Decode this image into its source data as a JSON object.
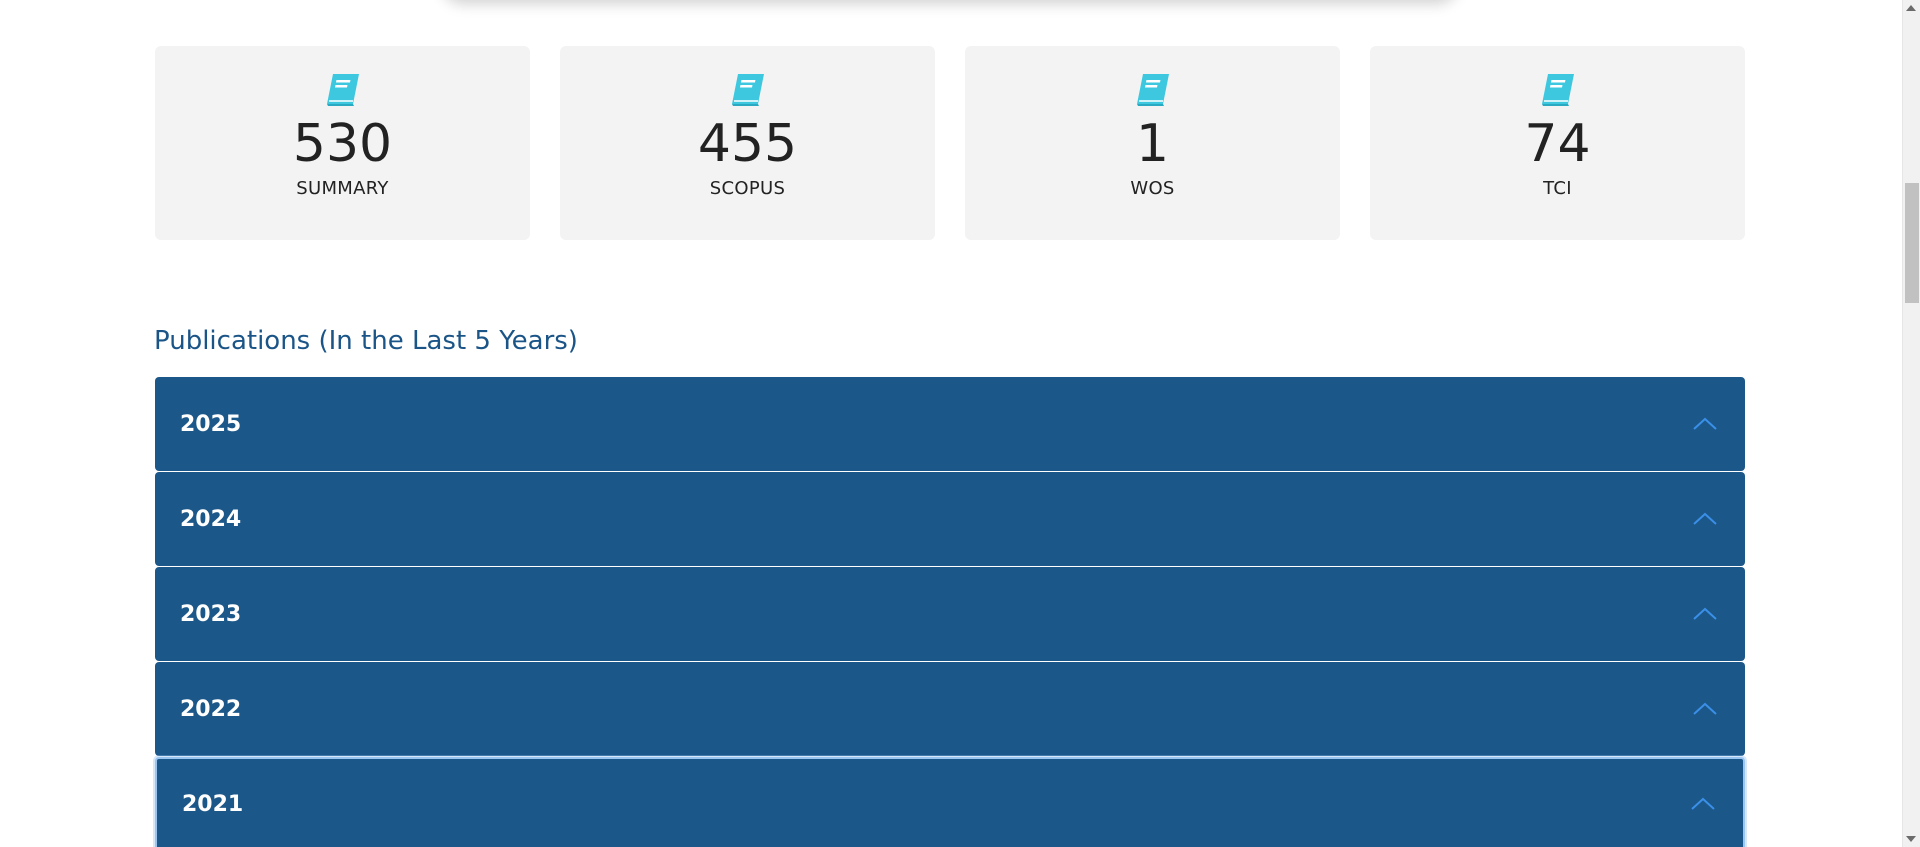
{
  "stats": [
    {
      "value": "530",
      "label": "SUMMARY",
      "icon": "book-icon"
    },
    {
      "value": "455",
      "label": "SCOPUS",
      "icon": "book-icon"
    },
    {
      "value": "1",
      "label": "WOS",
      "icon": "book-icon"
    },
    {
      "value": "74",
      "label": "TCI",
      "icon": "book-icon"
    }
  ],
  "section": {
    "title": "Publications (In the Last 5 Years)"
  },
  "accordion": {
    "items": [
      {
        "year": "2025"
      },
      {
        "year": "2024"
      },
      {
        "year": "2023"
      },
      {
        "year": "2022"
      },
      {
        "year": "2021"
      }
    ]
  },
  "colors": {
    "accordion_bg": "#1b5789",
    "title": "#1b5588",
    "icon": "#3ec8e0",
    "chevron": "#3a8fe8"
  }
}
